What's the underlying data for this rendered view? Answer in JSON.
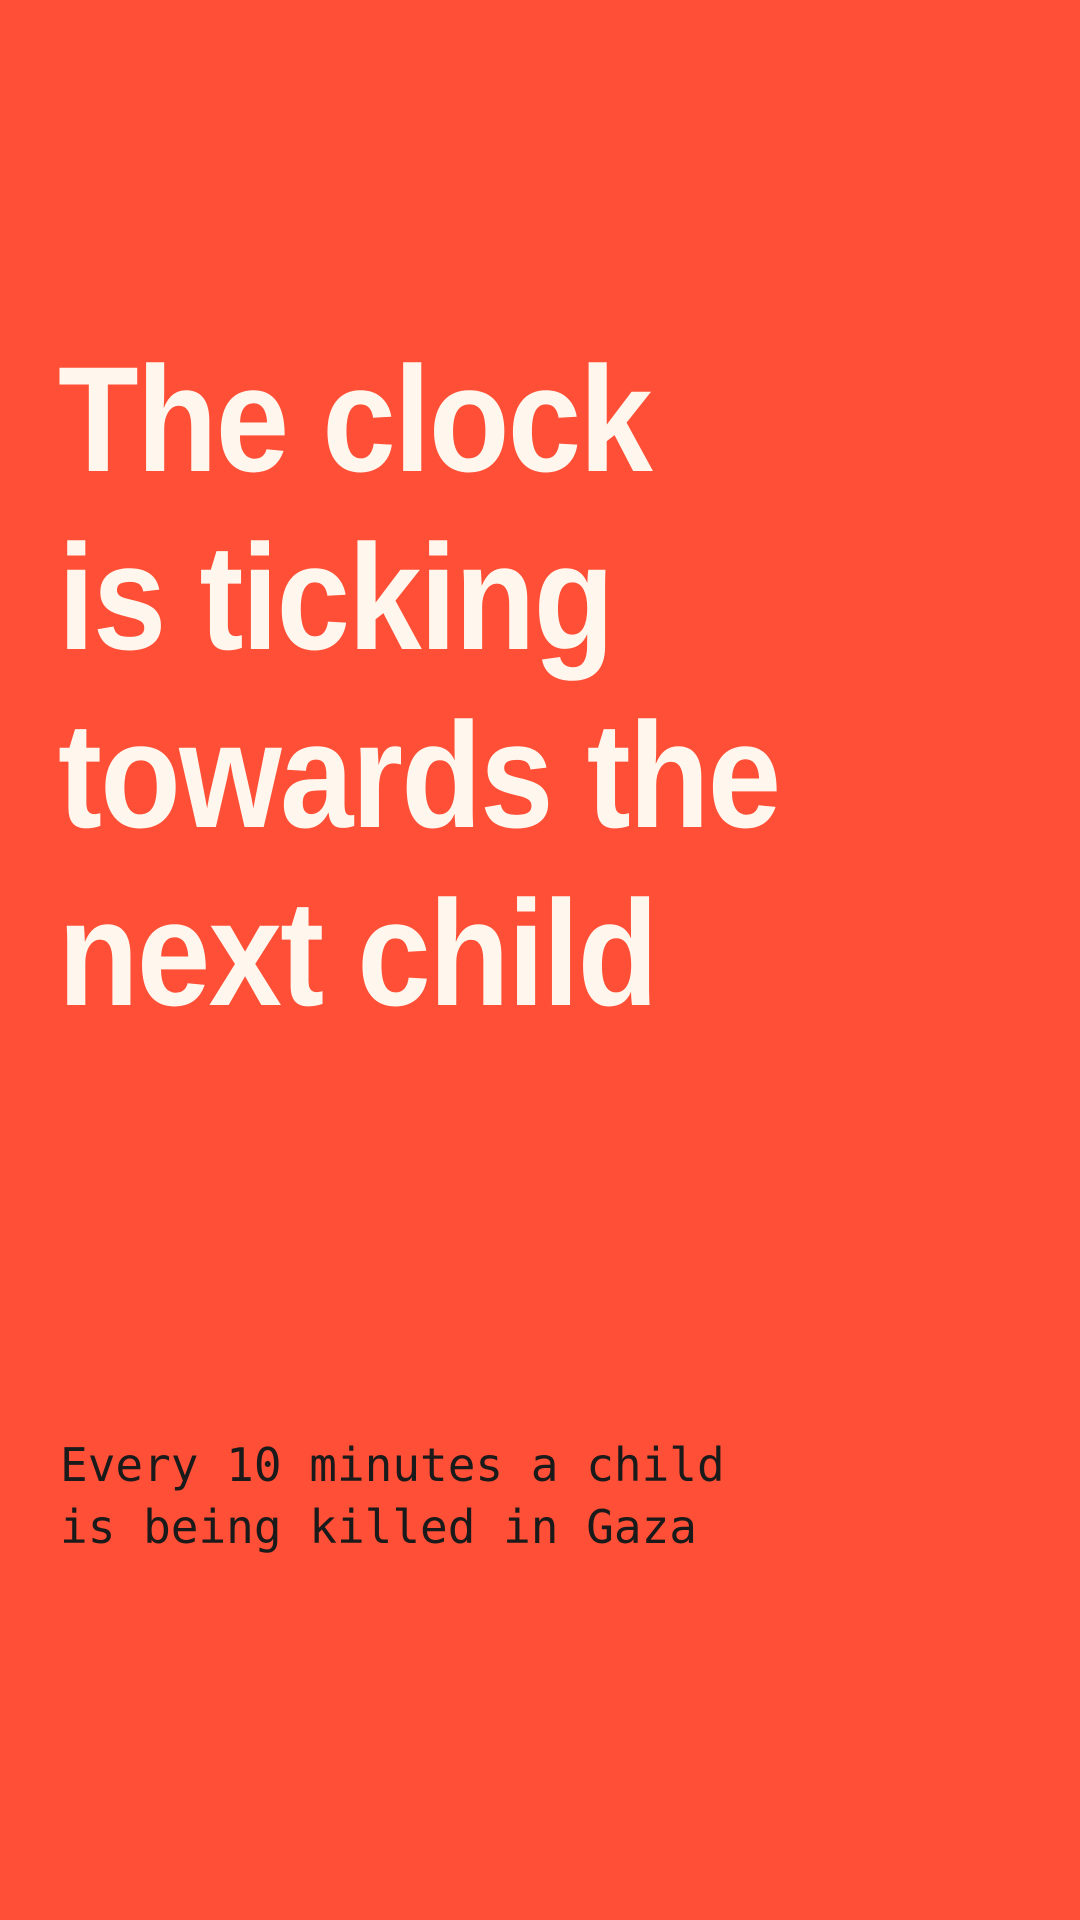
{
  "poster": {
    "background_color": "#FF4F36",
    "headline_color": "#FFF7EE",
    "subtext_color": "#1A1A1A",
    "headline_lines": [
      "The clock",
      "is ticking",
      "towards the",
      "next child"
    ],
    "subtext_lines": [
      "Every 10 minutes a child",
      "is being killed in Gaza"
    ]
  }
}
